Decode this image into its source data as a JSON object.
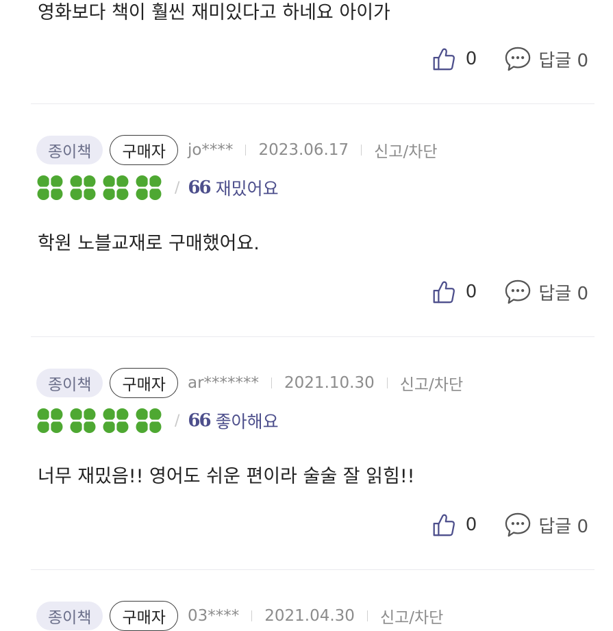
{
  "colors": {
    "accent": "#4d4f8c",
    "clover": "#4ea832",
    "badge_bg": "#ebebf5"
  },
  "icons": {
    "clover": "four-leaf-clover-icon",
    "like": "thumbs-up-icon",
    "reply": "speech-bubble-icon",
    "quote": "quote-mark"
  },
  "reviews": [
    {
      "body": "영화보다 책이 훨씬 재미있다고 하네요 아이가",
      "likes": "0",
      "reply_label": "답글 0"
    },
    {
      "type_badge": "종이책",
      "buyer_badge": "구매자",
      "user": "jo****",
      "date": "2023.06.17",
      "report": "신고/차단",
      "rating_clovers": 4,
      "quote": "66",
      "rating_label": "재밌어요",
      "body": "학원 노블교재로 구매했어요.",
      "likes": "0",
      "reply_label": "답글 0"
    },
    {
      "type_badge": "종이책",
      "buyer_badge": "구매자",
      "user": "ar*******",
      "date": "2021.10.30",
      "report": "신고/차단",
      "rating_clovers": 4,
      "quote": "66",
      "rating_label": "좋아해요",
      "body": "너무 재밌음!! 영어도 쉬운 편이라 술술 잘 읽힘!!",
      "likes": "0",
      "reply_label": "답글 0"
    },
    {
      "type_badge": "종이책",
      "buyer_badge": "구매자",
      "user": "03****",
      "date": "2021.04.30",
      "report": "신고/차단"
    }
  ]
}
